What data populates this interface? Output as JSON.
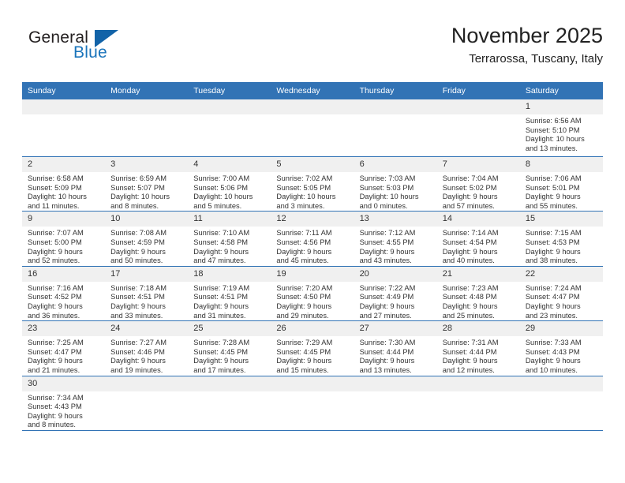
{
  "brand": {
    "name_top": "General",
    "name_bottom": "Blue",
    "top_color": "#231f20",
    "bottom_color": "#1a74bb",
    "triangle_color": "#1263a8"
  },
  "header": {
    "title": "November 2025",
    "subtitle": "Terrarossa, Tuscany, Italy"
  },
  "theme": {
    "header_bar": "#3273b5",
    "daynum_band": "#f0f0f0",
    "row_divider": "#3273b5",
    "text": "#333333"
  },
  "weekdays": [
    "Sunday",
    "Monday",
    "Tuesday",
    "Wednesday",
    "Thursday",
    "Friday",
    "Saturday"
  ],
  "weeks": [
    [
      {
        "day": "",
        "blank": true
      },
      {
        "day": "",
        "blank": true
      },
      {
        "day": "",
        "blank": true
      },
      {
        "day": "",
        "blank": true
      },
      {
        "day": "",
        "blank": true
      },
      {
        "day": "",
        "blank": true
      },
      {
        "day": "1",
        "sunrise": "Sunrise: 6:56 AM",
        "sunset": "Sunset: 5:10 PM",
        "daylight_1": "Daylight: 10 hours",
        "daylight_2": "and 13 minutes."
      }
    ],
    [
      {
        "day": "2",
        "sunrise": "Sunrise: 6:58 AM",
        "sunset": "Sunset: 5:09 PM",
        "daylight_1": "Daylight: 10 hours",
        "daylight_2": "and 11 minutes."
      },
      {
        "day": "3",
        "sunrise": "Sunrise: 6:59 AM",
        "sunset": "Sunset: 5:07 PM",
        "daylight_1": "Daylight: 10 hours",
        "daylight_2": "and 8 minutes."
      },
      {
        "day": "4",
        "sunrise": "Sunrise: 7:00 AM",
        "sunset": "Sunset: 5:06 PM",
        "daylight_1": "Daylight: 10 hours",
        "daylight_2": "and 5 minutes."
      },
      {
        "day": "5",
        "sunrise": "Sunrise: 7:02 AM",
        "sunset": "Sunset: 5:05 PM",
        "daylight_1": "Daylight: 10 hours",
        "daylight_2": "and 3 minutes."
      },
      {
        "day": "6",
        "sunrise": "Sunrise: 7:03 AM",
        "sunset": "Sunset: 5:03 PM",
        "daylight_1": "Daylight: 10 hours",
        "daylight_2": "and 0 minutes."
      },
      {
        "day": "7",
        "sunrise": "Sunrise: 7:04 AM",
        "sunset": "Sunset: 5:02 PM",
        "daylight_1": "Daylight: 9 hours",
        "daylight_2": "and 57 minutes."
      },
      {
        "day": "8",
        "sunrise": "Sunrise: 7:06 AM",
        "sunset": "Sunset: 5:01 PM",
        "daylight_1": "Daylight: 9 hours",
        "daylight_2": "and 55 minutes."
      }
    ],
    [
      {
        "day": "9",
        "sunrise": "Sunrise: 7:07 AM",
        "sunset": "Sunset: 5:00 PM",
        "daylight_1": "Daylight: 9 hours",
        "daylight_2": "and 52 minutes."
      },
      {
        "day": "10",
        "sunrise": "Sunrise: 7:08 AM",
        "sunset": "Sunset: 4:59 PM",
        "daylight_1": "Daylight: 9 hours",
        "daylight_2": "and 50 minutes."
      },
      {
        "day": "11",
        "sunrise": "Sunrise: 7:10 AM",
        "sunset": "Sunset: 4:58 PM",
        "daylight_1": "Daylight: 9 hours",
        "daylight_2": "and 47 minutes."
      },
      {
        "day": "12",
        "sunrise": "Sunrise: 7:11 AM",
        "sunset": "Sunset: 4:56 PM",
        "daylight_1": "Daylight: 9 hours",
        "daylight_2": "and 45 minutes."
      },
      {
        "day": "13",
        "sunrise": "Sunrise: 7:12 AM",
        "sunset": "Sunset: 4:55 PM",
        "daylight_1": "Daylight: 9 hours",
        "daylight_2": "and 43 minutes."
      },
      {
        "day": "14",
        "sunrise": "Sunrise: 7:14 AM",
        "sunset": "Sunset: 4:54 PM",
        "daylight_1": "Daylight: 9 hours",
        "daylight_2": "and 40 minutes."
      },
      {
        "day": "15",
        "sunrise": "Sunrise: 7:15 AM",
        "sunset": "Sunset: 4:53 PM",
        "daylight_1": "Daylight: 9 hours",
        "daylight_2": "and 38 minutes."
      }
    ],
    [
      {
        "day": "16",
        "sunrise": "Sunrise: 7:16 AM",
        "sunset": "Sunset: 4:52 PM",
        "daylight_1": "Daylight: 9 hours",
        "daylight_2": "and 36 minutes."
      },
      {
        "day": "17",
        "sunrise": "Sunrise: 7:18 AM",
        "sunset": "Sunset: 4:51 PM",
        "daylight_1": "Daylight: 9 hours",
        "daylight_2": "and 33 minutes."
      },
      {
        "day": "18",
        "sunrise": "Sunrise: 7:19 AM",
        "sunset": "Sunset: 4:51 PM",
        "daylight_1": "Daylight: 9 hours",
        "daylight_2": "and 31 minutes."
      },
      {
        "day": "19",
        "sunrise": "Sunrise: 7:20 AM",
        "sunset": "Sunset: 4:50 PM",
        "daylight_1": "Daylight: 9 hours",
        "daylight_2": "and 29 minutes."
      },
      {
        "day": "20",
        "sunrise": "Sunrise: 7:22 AM",
        "sunset": "Sunset: 4:49 PM",
        "daylight_1": "Daylight: 9 hours",
        "daylight_2": "and 27 minutes."
      },
      {
        "day": "21",
        "sunrise": "Sunrise: 7:23 AM",
        "sunset": "Sunset: 4:48 PM",
        "daylight_1": "Daylight: 9 hours",
        "daylight_2": "and 25 minutes."
      },
      {
        "day": "22",
        "sunrise": "Sunrise: 7:24 AM",
        "sunset": "Sunset: 4:47 PM",
        "daylight_1": "Daylight: 9 hours",
        "daylight_2": "and 23 minutes."
      }
    ],
    [
      {
        "day": "23",
        "sunrise": "Sunrise: 7:25 AM",
        "sunset": "Sunset: 4:47 PM",
        "daylight_1": "Daylight: 9 hours",
        "daylight_2": "and 21 minutes."
      },
      {
        "day": "24",
        "sunrise": "Sunrise: 7:27 AM",
        "sunset": "Sunset: 4:46 PM",
        "daylight_1": "Daylight: 9 hours",
        "daylight_2": "and 19 minutes."
      },
      {
        "day": "25",
        "sunrise": "Sunrise: 7:28 AM",
        "sunset": "Sunset: 4:45 PM",
        "daylight_1": "Daylight: 9 hours",
        "daylight_2": "and 17 minutes."
      },
      {
        "day": "26",
        "sunrise": "Sunrise: 7:29 AM",
        "sunset": "Sunset: 4:45 PM",
        "daylight_1": "Daylight: 9 hours",
        "daylight_2": "and 15 minutes."
      },
      {
        "day": "27",
        "sunrise": "Sunrise: 7:30 AM",
        "sunset": "Sunset: 4:44 PM",
        "daylight_1": "Daylight: 9 hours",
        "daylight_2": "and 13 minutes."
      },
      {
        "day": "28",
        "sunrise": "Sunrise: 7:31 AM",
        "sunset": "Sunset: 4:44 PM",
        "daylight_1": "Daylight: 9 hours",
        "daylight_2": "and 12 minutes."
      },
      {
        "day": "29",
        "sunrise": "Sunrise: 7:33 AM",
        "sunset": "Sunset: 4:43 PM",
        "daylight_1": "Daylight: 9 hours",
        "daylight_2": "and 10 minutes."
      }
    ],
    [
      {
        "day": "30",
        "sunrise": "Sunrise: 7:34 AM",
        "sunset": "Sunset: 4:43 PM",
        "daylight_1": "Daylight: 9 hours",
        "daylight_2": "and 8 minutes."
      },
      {
        "day": "",
        "blank": true
      },
      {
        "day": "",
        "blank": true
      },
      {
        "day": "",
        "blank": true
      },
      {
        "day": "",
        "blank": true
      },
      {
        "day": "",
        "blank": true
      },
      {
        "day": "",
        "blank": true
      }
    ]
  ]
}
